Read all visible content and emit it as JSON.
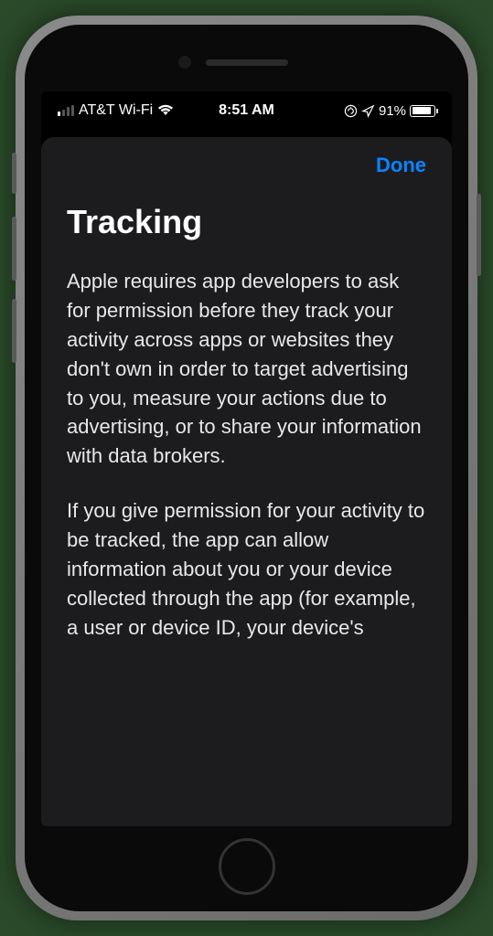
{
  "statusBar": {
    "carrier": "AT&T Wi-Fi",
    "time": "8:51 AM",
    "batteryPercent": "91%"
  },
  "modal": {
    "doneLabel": "Done",
    "title": "Tracking",
    "paragraph1": "Apple requires app developers to ask for permission before they track your activity across apps or websites they don't own in order to target advertising to you, measure your actions due to advertising, or to share your information with data brokers.",
    "paragraph2": "If you give permission for your activity to be tracked, the app can allow information about you or your device collected through the app (for example, a user or device ID, your device's"
  }
}
